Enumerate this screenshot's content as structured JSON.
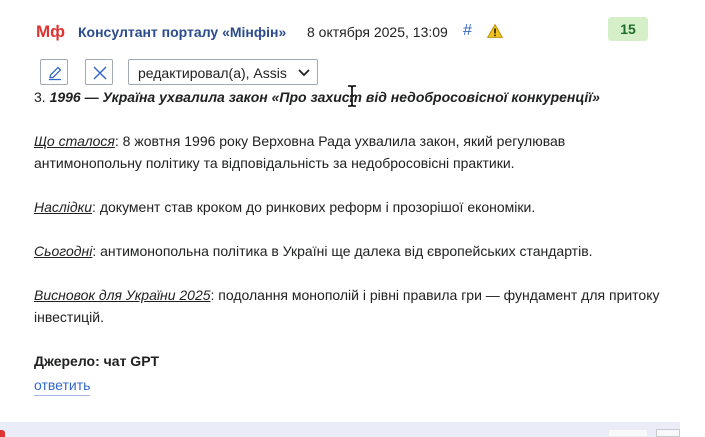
{
  "header": {
    "logo": "Мф",
    "author": "Консултант порталу «Мінфін»",
    "timestamp": "8 октября 2025, 13:09",
    "hash": "#",
    "badge": "15"
  },
  "toolbar": {
    "dropdown_value": "редактировал(а), Assis"
  },
  "content": {
    "title_number": "3. ",
    "title_text": "1996 — Україна ухвалила закон «Про захист від недобросовісної конкуренції»",
    "p1_label": "Що сталося",
    "p1_text": ": 8 жовтня 1996 року Верховна Рада ухвалила закон, який регулював антимонопольну політику та відповідальність за недобросовісні практики.",
    "p2_label": "Наслідки",
    "p2_text": ": документ став кроком до ринкових реформ і прозорішої економіки.",
    "p3_label": "Сьогодні",
    "p3_text": ": антимонопольна політика в Україні ще далека від європейських стандартів.",
    "p4_label": "Висновок для України 2025",
    "p4_text": ": подолання монополій і рівні правила гри — фундамент для притоку інвестицій.",
    "source": "Джерело: чат GPT"
  },
  "actions": {
    "reply": "ответить"
  },
  "colors": {
    "author": "#2a4b8d",
    "logo": "#dd3333",
    "badge_bg": "#d5f0c8",
    "link": "#3366cc"
  }
}
